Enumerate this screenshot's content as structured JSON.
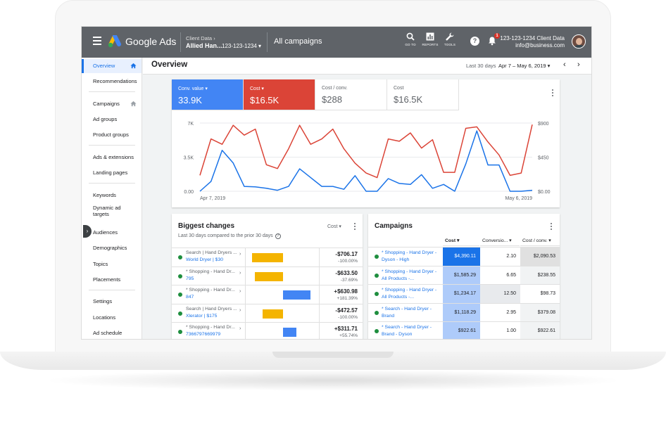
{
  "topbar": {
    "brand": "Google Ads",
    "client_label": "Client Data",
    "client_chevron": "›",
    "client_name": "Allied Han...",
    "client_id": "123-123-1234 ▾",
    "campaigns_label": "All campaigns",
    "tools": [
      {
        "icon": "search-icon",
        "label": "GO TO"
      },
      {
        "icon": "reports-icon",
        "label": "REPORTS"
      },
      {
        "icon": "wrench-icon",
        "label": "TOOLS"
      }
    ],
    "help_glyph": "?",
    "notification_count": "1",
    "account_line1": "123-123-1234 Client Data",
    "account_line2": "info@business.com"
  },
  "sidebar": {
    "items": [
      {
        "label": "Overview",
        "active": true
      },
      {
        "label": "Recommendations"
      },
      {
        "label": "Campaigns"
      },
      {
        "label": "Ad groups"
      },
      {
        "label": "Product groups"
      },
      {
        "label": "Ads & extensions"
      },
      {
        "label": "Landing pages"
      },
      {
        "label": "Keywords"
      },
      {
        "label": "Dynamic ad targets"
      },
      {
        "label": "Audiences"
      },
      {
        "label": "Demographics"
      },
      {
        "label": "Topics"
      },
      {
        "label": "Placements"
      },
      {
        "label": "Settings"
      },
      {
        "label": "Locations"
      },
      {
        "label": "Ad schedule"
      }
    ],
    "collapse_glyph": "›"
  },
  "overview": {
    "title": "Overview",
    "range_label": "Last 30 days",
    "range_value": "Apr 7 – May 6, 2019 ▾",
    "prev_glyph": "‹",
    "next_glyph": "›"
  },
  "metrics": [
    {
      "label": "Conv. value ▾",
      "value": "33.9K",
      "color": "#4285f4"
    },
    {
      "label": "Cost ▾",
      "value": "$16.5K",
      "color": "#db4437"
    },
    {
      "label": "Cost / conv.",
      "value": "$288"
    },
    {
      "label": "Cost",
      "value": "$16.5K"
    }
  ],
  "chart_data": {
    "type": "line",
    "x_start_label": "Apr 7, 2019",
    "x_end_label": "May 6, 2019",
    "left_axis": {
      "ticks": [
        "7K",
        "3.5K",
        "0.00"
      ],
      "ylim": [
        0,
        7000
      ]
    },
    "right_axis": {
      "ticks": [
        "$900",
        "$450",
        "$0.00"
      ],
      "ylim": [
        0,
        900
      ]
    },
    "grid": true,
    "series": [
      {
        "color": "#db4437",
        "axis": "right",
        "values": [
          210,
          690,
          620,
          870,
          740,
          820,
          350,
          300,
          560,
          870,
          620,
          690,
          820,
          560,
          370,
          240,
          180,
          690,
          660,
          770,
          570,
          680,
          250,
          250,
          830,
          850,
          650,
          480,
          210,
          240,
          880
        ]
      },
      {
        "color": "#1a73e8",
        "axis": "left",
        "values": [
          0,
          1000,
          4200,
          2900,
          500,
          450,
          300,
          100,
          500,
          2300,
          1400,
          500,
          500,
          200,
          1600,
          0,
          0,
          1300,
          800,
          700,
          1700,
          300,
          700,
          0,
          2800,
          6200,
          2700,
          2700,
          0,
          0,
          100
        ]
      }
    ]
  },
  "biggest_changes": {
    "title": "Biggest changes",
    "subtitle": "Last 30 days compared to the prior 30 days",
    "info_glyph": "?",
    "metric_dropdown": "Cost ▾",
    "chevron": "›",
    "rows": [
      {
        "line1": "Search | Hand Dryers ...",
        "line2": "World Dryer | $30",
        "value": "-$706.17",
        "pct": "-100.00%",
        "bar_color": "#f4b400",
        "direction": "neg",
        "magnitude": 1.0
      },
      {
        "line1": "* Shopping - Hand Dr...",
        "line2": "795",
        "value": "-$633.50",
        "pct": "-37.69%",
        "bar_color": "#f4b400",
        "direction": "neg",
        "magnitude": 0.9
      },
      {
        "line1": "* Shopping - Hand Dr...",
        "line2": "847",
        "value": "+$630.98",
        "pct": "+181.39%",
        "bar_color": "#4285f4",
        "direction": "pos",
        "magnitude": 0.89
      },
      {
        "line1": "Search | Hand Dryers ...",
        "line2": "Xlerator | $175",
        "value": "-$472.57",
        "pct": "-100.00%",
        "bar_color": "#f4b400",
        "direction": "neg",
        "magnitude": 0.67
      },
      {
        "line1": "* Shopping - Hand Dr...",
        "line2": "7366797669979",
        "value": "+$311.71",
        "pct": "+55.74%",
        "bar_color": "#4285f4",
        "direction": "pos",
        "magnitude": 0.44
      }
    ]
  },
  "campaigns": {
    "title": "Campaigns",
    "headers": [
      "Cost ▾",
      "Conversio... ▾",
      "Cost / conv. ▾"
    ],
    "rows": [
      {
        "name": "* Shopping - Hand Dryer - Dyson - High",
        "cost": "$4,390.11",
        "conv": "2.10",
        "cpc": "$2,090.53",
        "cost_color": "#1a73e8",
        "conv_color": "#ffffff",
        "cpc_color": "#e0e0e0"
      },
      {
        "name": "* Shopping - Hand Dryer - All Products -...",
        "cost": "$1,585.29",
        "conv": "6.65",
        "cpc": "$238.55",
        "cost_color": "#aecbfa",
        "conv_color": "#ffffff",
        "cpc_color": "#f1f3f4"
      },
      {
        "name": "* Shopping - Hand Dryer - All Products -...",
        "cost": "$1,234.17",
        "conv": "12.50",
        "cpc": "$98.73",
        "cost_color": "#aecbfa",
        "conv_color": "#e8eaed",
        "cpc_color": "#ffffff"
      },
      {
        "name": "* Search - Hand Dryer - Brand",
        "cost": "$1,118.29",
        "conv": "2.95",
        "cpc": "$379.08",
        "cost_color": "#aecbfa",
        "conv_color": "#ffffff",
        "cpc_color": "#f1f3f4"
      },
      {
        "name": "* Search - Hand Dryer - Brand - Dyson",
        "cost": "$922.61",
        "conv": "1.00",
        "cpc": "$922.61",
        "cost_color": "#aecbfa",
        "conv_color": "#ffffff",
        "cpc_color": "#f1f3f4"
      }
    ]
  }
}
